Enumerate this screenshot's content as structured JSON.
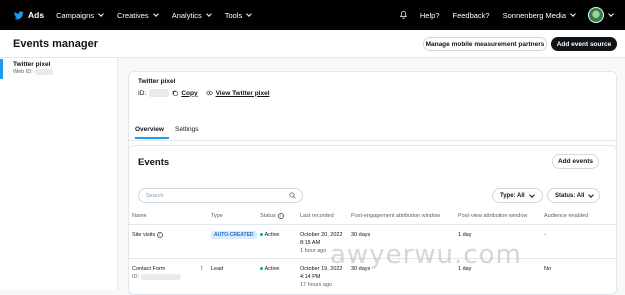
{
  "topbar": {
    "brand": "Ads",
    "nav": [
      {
        "label": "Campaigns"
      },
      {
        "label": "Creatives"
      },
      {
        "label": "Analytics"
      },
      {
        "label": "Tools"
      }
    ],
    "help": "Help?",
    "feedback": "Feedback?",
    "account": "Sonnenberg Media"
  },
  "header": {
    "title": "Events manager",
    "manage_btn": "Manage mobile measurement partners",
    "add_source_btn": "Add event source"
  },
  "sidebar": {
    "item_title": "Twitter pixel",
    "item_sub": "Web ID:"
  },
  "pixel_card": {
    "name": "Twitter pixel",
    "id_label": "ID:",
    "copy": "Copy",
    "view": "View Twitter pixel"
  },
  "tabs": [
    {
      "label": "Overview"
    },
    {
      "label": "Settings"
    }
  ],
  "events": {
    "title": "Events",
    "add_btn": "Add events",
    "search_placeholder": "Search",
    "type_filter": "Type: All",
    "status_filter": "Status: All",
    "columns": [
      "Name",
      "Type",
      "Status",
      "Last recorded",
      "Post-engagement attribution window",
      "Post-view attribution window",
      "Audience enabled"
    ],
    "rows": [
      {
        "name": "Site visits",
        "type": "AUTO-CREATED",
        "status": "Active",
        "last_date": "October 20, 2022",
        "last_time": "8:15 AM",
        "last_ago": "1 hour ago",
        "post_engagement": "30 days",
        "post_view": "1 day",
        "audience": "-"
      },
      {
        "name": "Contact Form",
        "id_label": "ID:",
        "type": "Lead",
        "status": "Active",
        "last_date": "October 19, 2022",
        "last_time": "4:14 PM",
        "last_ago": "17 hours ago",
        "post_engagement": "30 days",
        "post_view": "1 day",
        "audience": "No"
      }
    ]
  },
  "watermark": "awyerwu.com",
  "colors": {
    "accent": "#1d9bf0",
    "active": "#00ba7c",
    "dark": "#0f1419"
  }
}
